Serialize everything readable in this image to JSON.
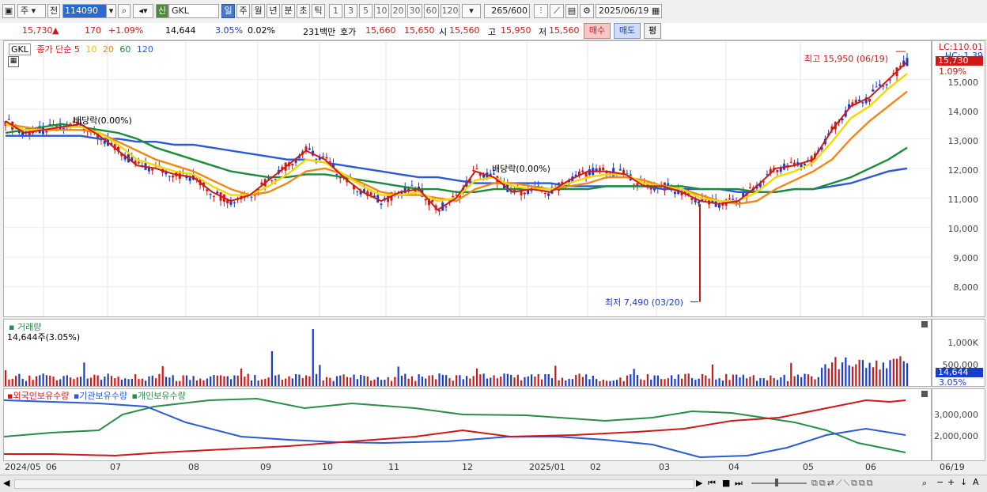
{
  "toolbar": {
    "period_main": "주",
    "period_prev": "전",
    "code": "114090",
    "new_badge": "신",
    "stock_name": "GKL",
    "periods": [
      "일",
      "주",
      "월",
      "년",
      "분",
      "초",
      "틱"
    ],
    "ticks": [
      "1",
      "3",
      "5",
      "10",
      "20",
      "30",
      "60",
      "120"
    ],
    "count": "265",
    "count_total": "/600",
    "date": "2025/06/19"
  },
  "quote": {
    "price": "15,730",
    "arrow": "▲",
    "change": "170",
    "change_pct": "+1.09%",
    "volume": "14,644",
    "turnover_pct": "3.05%",
    "ratio": "0.02%",
    "amount": "231백만",
    "hoga_label": "호가",
    "ask": "15,660",
    "bid": "15,650",
    "open_label": "시",
    "open": "15,560",
    "high_label": "고",
    "high": "15,950",
    "low_label": "저",
    "low": "15,560",
    "buy_button": "매수",
    "sell_button": "매도",
    "avg_button": "평"
  },
  "legend": {
    "name": "GKL",
    "title": "종가 단순",
    "ma": [
      "5",
      "10",
      "20",
      "60",
      "120"
    ],
    "ma_colors": [
      "#d01818",
      "#f0c000",
      "#e88818",
      "#1a8c3a",
      "#2a5ad8"
    ]
  },
  "price_axis": {
    "lc": "LC:110.01",
    "hc": "HC:-1.39",
    "current": "15,730",
    "current_pct": "1.09%",
    "labels": [
      "15,000",
      "14,000",
      "13,000",
      "12,000",
      "11,000",
      "10,000",
      "9,000",
      "8,000"
    ]
  },
  "annotations": {
    "high": "최고 15,950 (06/19)",
    "low": "최저 7,490 (03/20)",
    "div1": "배당락(0.00%)",
    "div2": "배당락(0.00%)"
  },
  "volume": {
    "title": "거래량",
    "value": "14,644주(3.05%)",
    "axis": [
      "1,000K",
      "500,000"
    ],
    "current": "14,644",
    "current_pct": "3.05%"
  },
  "holdings": {
    "legends": [
      "외국인보유수량",
      "기관보유수량",
      "개인보유수량"
    ],
    "colors": [
      "#d01818",
      "#2a5ad8",
      "#2a8c4a"
    ],
    "axis": [
      "3,000,000",
      "2,000,000"
    ]
  },
  "x_labels": [
    "2024/05",
    "06",
    "07",
    "08",
    "09",
    "10",
    "11",
    "12",
    "2025/01",
    "02",
    "03",
    "04",
    "05",
    "06",
    "06/19"
  ],
  "chart_data": {
    "type": "line",
    "title": "GKL 종가 단순",
    "ylim": [
      7000,
      16300
    ],
    "series": [
      {
        "name": "5",
        "values": [
          13600,
          13200,
          13300,
          13400,
          13500,
          13100,
          12600,
          12100,
          12000,
          11800,
          11700,
          11200,
          10900,
          11100,
          11600,
          12100,
          12600,
          12300,
          11700,
          11200,
          10900,
          11200,
          11300,
          10600,
          11000,
          11900,
          11700,
          11200,
          11300,
          11200,
          11600,
          11900,
          11900,
          11800,
          11400,
          11400,
          11200,
          10900,
          10800,
          10900,
          11400,
          12000,
          12100,
          12300,
          13300,
          14100,
          14400,
          15000,
          15600
        ]
      },
      {
        "name": "10",
        "values": [
          13500,
          13300,
          13300,
          13400,
          13400,
          13200,
          12800,
          12300,
          12100,
          11900,
          11800,
          11400,
          11100,
          11100,
          11400,
          11800,
          12300,
          12200,
          11800,
          11400,
          11100,
          11100,
          11200,
          10900,
          11000,
          11600,
          11700,
          11400,
          11300,
          11300,
          11500,
          11700,
          11800,
          11800,
          11500,
          11400,
          11300,
          11000,
          10900,
          10900,
          11200,
          11700,
          11900,
          12200,
          12900,
          13700,
          14100,
          14700,
          15200
        ]
      },
      {
        "name": "20",
        "values": [
          13500,
          13400,
          13300,
          13300,
          13300,
          13200,
          12900,
          12600,
          12300,
          12100,
          11900,
          11600,
          11300,
          11100,
          11200,
          11500,
          11900,
          12000,
          11800,
          11500,
          11200,
          11100,
          11100,
          11000,
          10900,
          11300,
          11500,
          11500,
          11400,
          11300,
          11400,
          11500,
          11700,
          11700,
          11600,
          11400,
          11300,
          11100,
          10900,
          10800,
          10900,
          11300,
          11600,
          11900,
          12300,
          13000,
          13600,
          14100,
          14600
        ]
      },
      {
        "name": "60",
        "values": [
          13200,
          13300,
          13400,
          13500,
          13400,
          13300,
          13200,
          13000,
          12700,
          12500,
          12300,
          12100,
          11900,
          11800,
          11700,
          11700,
          11800,
          11800,
          11700,
          11600,
          11500,
          11400,
          11300,
          11300,
          11200,
          11200,
          11300,
          11300,
          11300,
          11300,
          11300,
          11300,
          11400,
          11400,
          11400,
          11400,
          11400,
          11300,
          11300,
          11300,
          11200,
          11200,
          11300,
          11300,
          11500,
          11700,
          12000,
          12300,
          12700
        ]
      },
      {
        "name": "120",
        "values": [
          13100,
          13100,
          13100,
          13100,
          13100,
          13000,
          13000,
          12900,
          12900,
          12800,
          12800,
          12700,
          12600,
          12500,
          12400,
          12300,
          12300,
          12200,
          12100,
          12000,
          11900,
          11800,
          11700,
          11700,
          11600,
          11500,
          11500,
          11500,
          11500,
          11500,
          11400,
          11400,
          11400,
          11400,
          11400,
          11300,
          11300,
          11300,
          11300,
          11200,
          11200,
          11200,
          11300,
          11300,
          11400,
          11500,
          11700,
          11900,
          12000
        ]
      }
    ]
  }
}
